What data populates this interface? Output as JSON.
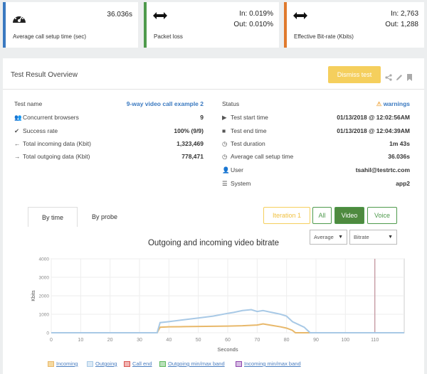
{
  "metrics": [
    {
      "label": "Average call setup time (sec)",
      "value": "36.036s",
      "icon": "speedometer-icon",
      "color": "#3a79c0"
    },
    {
      "label": "Packet loss",
      "in": "In: 0.019%",
      "out": "Out: 0.010%",
      "icon": "arrows-left-right-icon",
      "color": "#4e9a4c"
    },
    {
      "label": "Effective Bit-rate (Kbits)",
      "in": "In: 2,763",
      "out": "Out: 1,288",
      "icon": "arrows-left-right-icon",
      "color": "#e07a2e"
    }
  ],
  "panel": {
    "title": "Test Result Overview",
    "dismiss_label": "Dismiss test",
    "icons": [
      "share-icon",
      "edit-icon",
      "bookmark-icon"
    ]
  },
  "summary_left": [
    {
      "icon": "",
      "label": "Test name",
      "value": "9-way video call example 2",
      "link": true
    },
    {
      "icon": "users-icon",
      "label": "Concurrent browsers",
      "value": "9"
    },
    {
      "icon": "check-icon",
      "label": "Success rate",
      "value": "100% (9/9)"
    },
    {
      "icon": "arrow-left-icon",
      "label": "Total incoming data (Kbit)",
      "value": "1,323,469"
    },
    {
      "icon": "arrow-right-icon",
      "label": "Total outgoing data (Kbit)",
      "value": "778,471"
    }
  ],
  "summary_right": [
    {
      "icon": "",
      "label": "Status",
      "value": "warnings",
      "warning": true
    },
    {
      "icon": "play-icon",
      "label": "Test start time",
      "value": "01/13/2018 @ 12:02:56AM"
    },
    {
      "icon": "stop-icon",
      "label": "Test end time",
      "value": "01/13/2018 @ 12:04:39AM"
    },
    {
      "icon": "clock-icon",
      "label": "Test duration",
      "value": "1m 43s"
    },
    {
      "icon": "clock-icon",
      "label": "Average call setup time",
      "value": "36.036s"
    },
    {
      "icon": "user-icon",
      "label": "User",
      "value": "tsahil@testrtc.com"
    },
    {
      "icon": "server-icon",
      "label": "System",
      "value": "app2"
    }
  ],
  "tabs": [
    {
      "label": "By time",
      "active": true
    },
    {
      "label": "By probe",
      "active": false
    }
  ],
  "filters": [
    {
      "label": "Iteration 1",
      "style": "warn"
    },
    {
      "label": "All",
      "style": "outline"
    },
    {
      "label": "Video",
      "style": "active"
    },
    {
      "label": "Voice",
      "style": "outline"
    }
  ],
  "selects": {
    "aggregate": "Average",
    "metric": "Bitrate"
  },
  "chart_data": {
    "type": "line",
    "title": "Outgoing and incoming video bitrate",
    "xlabel": "Seconds",
    "ylabel": "Kbits",
    "xlim": [
      0,
      120
    ],
    "ylim": [
      0,
      4000
    ],
    "x_ticks": [
      0,
      10,
      20,
      30,
      40,
      50,
      60,
      70,
      80,
      90,
      100,
      110
    ],
    "y_ticks": [
      0,
      1000,
      2000,
      3000,
      4000
    ],
    "grid": true,
    "call_end_x": 110,
    "series": [
      {
        "name": "Incoming",
        "color": "#e8b86a",
        "x": [
          0,
          36,
          37,
          40,
          45,
          50,
          55,
          60,
          65,
          70,
          72,
          75,
          78,
          80,
          82,
          83,
          85,
          120
        ],
        "y": [
          0,
          0,
          300,
          320,
          330,
          340,
          350,
          360,
          380,
          420,
          480,
          400,
          320,
          250,
          130,
          0,
          0,
          0
        ]
      },
      {
        "name": "Outgoing",
        "color": "#a8c9e6",
        "x": [
          0,
          36,
          37,
          40,
          45,
          50,
          55,
          60,
          62,
          65,
          68,
          70,
          72,
          75,
          78,
          80,
          82,
          84,
          86,
          87,
          88,
          120
        ],
        "y": [
          0,
          0,
          550,
          600,
          700,
          800,
          900,
          1050,
          1100,
          1200,
          1250,
          1150,
          1200,
          1100,
          1000,
          900,
          600,
          450,
          300,
          150,
          0,
          0
        ]
      }
    ],
    "legend": [
      {
        "label": "Incoming",
        "color": "#e8b86a"
      },
      {
        "label": "Outgoing",
        "color": "#a8c9e6"
      },
      {
        "label": "Call end",
        "color": "#d9534f"
      },
      {
        "label": "Outgoing min/max band",
        "color": "#5cb85c"
      },
      {
        "label": "Incoming min/max band",
        "color": "#8e44ad"
      }
    ]
  }
}
